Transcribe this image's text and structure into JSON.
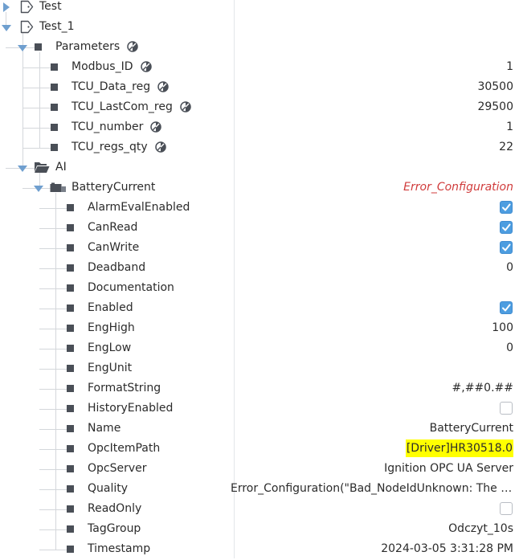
{
  "colors": {
    "expander": "#6f9fcf",
    "error_text": "#d03b3b",
    "highlight": "#ffff00",
    "checkbox_on": "#4d9de0",
    "node_square": "#4a4f57"
  },
  "rows": [
    {
      "label": "Test",
      "icon": "udt-tag-icon",
      "expander": "collapsed"
    },
    {
      "label": "Test_1",
      "icon": "udt-tag-icon",
      "expander": "expanded"
    },
    {
      "label": "Parameters",
      "icon": "square-node-icon",
      "expander": "expanded",
      "provider_icon": true
    },
    {
      "label": "Modbus_ID",
      "icon": "square-node-icon",
      "provider_icon": true,
      "value": "1"
    },
    {
      "label": "TCU_Data_reg",
      "icon": "square-node-icon",
      "provider_icon": true,
      "value": "30500"
    },
    {
      "label": "TCU_LastCom_reg",
      "icon": "square-node-icon",
      "provider_icon": true,
      "value": "29500"
    },
    {
      "label": "TCU_number",
      "icon": "square-node-icon",
      "provider_icon": true,
      "value": "1"
    },
    {
      "label": "TCU_regs_qty",
      "icon": "square-node-icon",
      "provider_icon": true,
      "value": "22"
    },
    {
      "label": "AI",
      "icon": "open-folder-icon",
      "expander": "expanded"
    },
    {
      "label": "BatteryCurrent",
      "icon": "opc-tag-icon",
      "expander": "expanded",
      "value": "Error_Configuration",
      "value_style": "error"
    },
    {
      "label": "AlarmEvalEnabled",
      "icon": "square-node-icon",
      "checkbox": true
    },
    {
      "label": "CanRead",
      "icon": "square-node-icon",
      "checkbox": true
    },
    {
      "label": "CanWrite",
      "icon": "square-node-icon",
      "checkbox": true
    },
    {
      "label": "Deadband",
      "icon": "square-node-icon",
      "value": "0"
    },
    {
      "label": "Documentation",
      "icon": "square-node-icon"
    },
    {
      "label": "Enabled",
      "icon": "square-node-icon",
      "checkbox": true
    },
    {
      "label": "EngHigh",
      "icon": "square-node-icon",
      "value": "100"
    },
    {
      "label": "EngLow",
      "icon": "square-node-icon",
      "value": "0"
    },
    {
      "label": "EngUnit",
      "icon": "square-node-icon"
    },
    {
      "label": "FormatString",
      "icon": "square-node-icon",
      "value": "#,##0.##"
    },
    {
      "label": "HistoryEnabled",
      "icon": "square-node-icon",
      "checkbox": false
    },
    {
      "label": "Name",
      "icon": "square-node-icon",
      "value": "BatteryCurrent"
    },
    {
      "label": "OpcItemPath",
      "icon": "square-node-icon",
      "value": "[Driver]HR30518.0",
      "value_style": "highlight"
    },
    {
      "label": "OpcServer",
      "icon": "square-node-icon",
      "value": "Ignition OPC UA Server"
    },
    {
      "label": "Quality",
      "icon": "square-node-icon",
      "value": "Error_Configuration(\"Bad_NodeIdUnknown: The node id refers to a node that does not exist in the server address space.\")"
    },
    {
      "label": "ReadOnly",
      "icon": "square-node-icon",
      "checkbox": false
    },
    {
      "label": "TagGroup",
      "icon": "square-node-icon",
      "value": "Odczyt_10s"
    },
    {
      "label": "Timestamp",
      "icon": "square-node-icon",
      "value": "2024-03-05 3:31:28 PM"
    }
  ]
}
